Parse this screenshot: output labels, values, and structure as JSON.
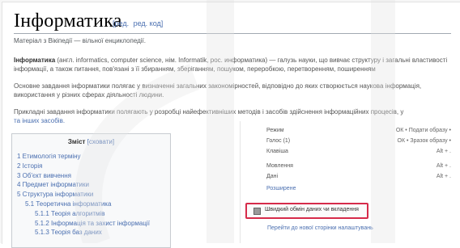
{
  "article": {
    "title": "Інформатика",
    "edit_links": [
      "[ред.",
      "ред. код]"
    ],
    "tagline": "Матеріал з Вікіпедії — вільної енциклопедії.",
    "para1_line1_bold": "Інформатика",
    "para1_line1_rest": " (англ. informatics, computer science, нім. Informatik, рос. информатика) — галузь науки, що вивчає структуру і загальні властивості",
    "para1_line2": "інформації, а також питання, пов'язані з її збиранням, зберіганням, пошуком, переробкою, перетворенням, поширенням",
    "para2_line1": "Основне завдання інформатики полягає у визначенні загальних закономірностей, відповідно до яких створюється наукова інформація,",
    "para2_line2": "використання у різних сферах діяльності людини.",
    "para3_line1": "Прикладні завдання інформатики полягають у розробці найефективніших методів і засобів здійснення інформаційних процесів, у",
    "para3_line2": "та інших засобів."
  },
  "toc": {
    "title": "Зміст",
    "hide_link": "[сховати]",
    "items": [
      {
        "label": "1 Етимологія терміну",
        "level": 1
      },
      {
        "label": "2 Історія",
        "level": 1
      },
      {
        "label": "3 Об'єкт вивчення",
        "level": 1
      },
      {
        "label": "4 Предмет інформатики",
        "level": 1
      },
      {
        "label": "5 Структура інформатики",
        "level": 1
      },
      {
        "label": "5.1 Теоретична інформатика",
        "level": 2
      },
      {
        "label": "5.1.1 Теорія алгоритмів",
        "level": 3
      },
      {
        "label": "5.1.2 Інформація та захист інформації",
        "level": 3
      },
      {
        "label": "5.1.3 Теорія баз даних",
        "level": 3
      }
    ]
  },
  "panel": {
    "rows": [
      {
        "k": "Режим",
        "v": "ОК • Подати образу •"
      },
      {
        "k": "Голос (1)",
        "v": "ОК • Зразок образу •"
      },
      {
        "k": "Клавіша",
        "v": "Alt + ."
      },
      {
        "k": "Мовлення",
        "v": "Alt + ."
      },
      {
        "k": "Дані",
        "v": "Alt + ."
      }
    ],
    "settings_link": "Розширене",
    "checkbox_label": "Швидкий обмін даних чи вкладення",
    "bottom_link": "Перейти до нової сторінки налаштувань"
  },
  "colors": {
    "highlight": "#d62b4a",
    "link": "#4a6fb0"
  }
}
